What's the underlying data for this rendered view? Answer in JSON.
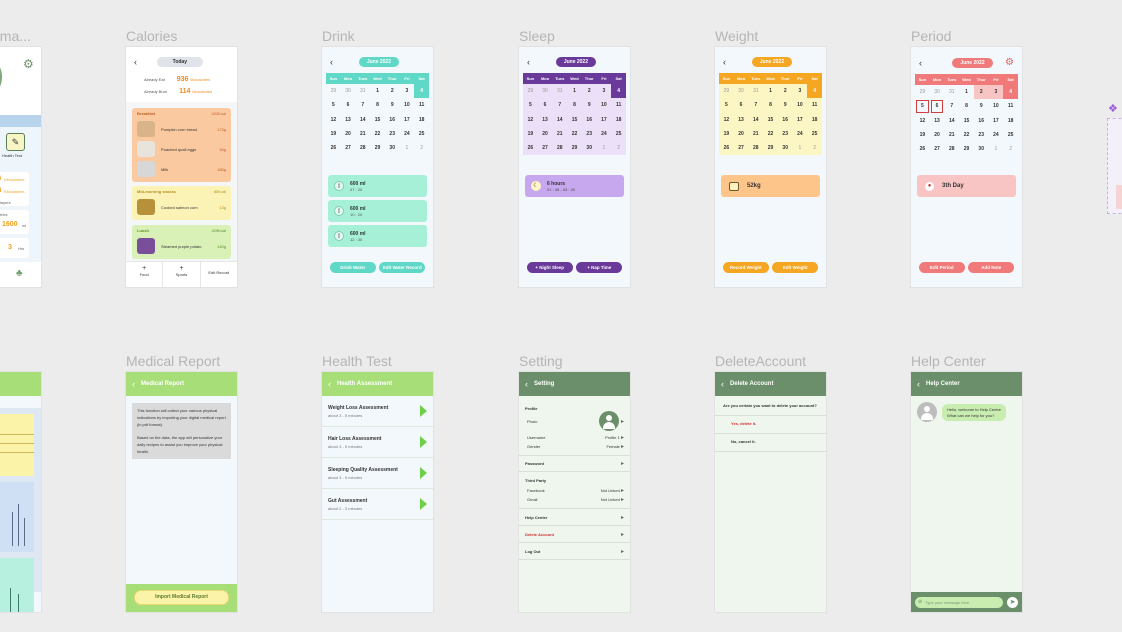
{
  "labels": {
    "partial": "oma...",
    "calories": "Calories",
    "drink": "Drink",
    "sleep": "Sleep",
    "weight": "Weight",
    "period": "Period",
    "medical": "Medical Report",
    "health": "Health Test",
    "setting": "Setting",
    "delete": "DeleteAccount",
    "help": "Help Center"
  },
  "home_partial": {
    "health_test": "Health Test",
    "val1": "6",
    "val1_unit": "Kilocalories",
    "val2": "4",
    "val2_unit": "Kilocalories",
    "bmi": "layers",
    "steps_label": "tries",
    "steps": "1600",
    "steps_unit": "ml",
    "sleep": "3",
    "sleep_unit": "Hrs"
  },
  "calories": {
    "today": "Today",
    "eaten_label": "Already Eat",
    "eaten_value": "936",
    "eaten_unit": "kilocalories",
    "burnt_label": "Already Burn",
    "burnt_value": "114",
    "burnt_unit": "kilocalories",
    "meals": [
      {
        "title": "Breakfast",
        "kcal": "422Kcal",
        "items": [
          {
            "name": "Pumpkin corn bread",
            "amount": "173g"
          },
          {
            "name": "Poached quail eggs",
            "amount": "45g"
          },
          {
            "name": "Milk",
            "amount": "180g"
          }
        ]
      },
      {
        "title": "Mid-morning snacks",
        "kcal": "85Kcal",
        "items": [
          {
            "name": "Cooked salmon corn",
            "amount": "13g"
          }
        ]
      },
      {
        "title": "Lunch",
        "kcal": "429Kcal",
        "items": [
          {
            "name": "Steamed purple potato",
            "amount": "140g"
          }
        ]
      }
    ],
    "footer": [
      {
        "icon": "+",
        "label": "Food"
      },
      {
        "icon": "+",
        "label": "Sports"
      },
      {
        "icon": "",
        "label": "Edit Record"
      }
    ]
  },
  "calendar": {
    "month": "June 2022",
    "weekdays": [
      "Sun",
      "Mon",
      "Tues",
      "Wed",
      "Thur",
      "Fri",
      "Sat"
    ],
    "days": [
      "29",
      "30",
      "31",
      "1",
      "2",
      "3",
      "4",
      "5",
      "6",
      "7",
      "8",
      "9",
      "10",
      "11",
      "12",
      "13",
      "14",
      "15",
      "16",
      "17",
      "18",
      "19",
      "20",
      "21",
      "22",
      "23",
      "24",
      "25",
      "26",
      "27",
      "28",
      "29",
      "30",
      "1",
      "2"
    ]
  },
  "drink": {
    "entries": [
      {
        "amount": "600 ml",
        "time": "07 : 20"
      },
      {
        "amount": "600 ml",
        "time": "10 : 20"
      },
      {
        "amount": "600 ml",
        "time": "12 : 30"
      }
    ],
    "btn1": "Drink Water",
    "btn2": "Edit Water Record"
  },
  "sleep": {
    "hours": "6 hours",
    "range": "21 : 45 - 03 : 20",
    "btn1": "+ Night Sleep",
    "btn2": "+ Nap Time"
  },
  "weight": {
    "value": "52kg",
    "btn1": "Record Weight",
    "btn2": "Edit Weight"
  },
  "period": {
    "day": "3th Day",
    "btn1": "Edit Period",
    "btn2": "Add Note"
  },
  "medical": {
    "header": "Medical Report",
    "para1": "This function will collect your various physical indications by importing your digital medical report (in pdf format).",
    "para2": "Based on the data, the app will personalize your daily recipes to assist you improve your physical health.",
    "btn": "Import Medical Report"
  },
  "health": {
    "header": "Health Assessment",
    "items": [
      {
        "title": "Weight Loss Assessment",
        "sub": "about 3 - 5 minutes"
      },
      {
        "title": "Hair Loss Assessment",
        "sub": "about 3 - 5 minutes"
      },
      {
        "title": "Sleeping Quality Assessment",
        "sub": "about 3 - 5 minutes"
      },
      {
        "title": "Gut Assessment",
        "sub": "about 2 - 3 minutes"
      }
    ]
  },
  "setting": {
    "header": "Setting",
    "profile": "Profile",
    "photo": "Photo",
    "username_label": "Username",
    "username_value": "Profile 1",
    "gender_label": "Gender",
    "gender_value": "Female",
    "password": "Password",
    "third_party": "Third Party",
    "facebook_label": "Facebook",
    "facebook_value": "Not Linked",
    "gmail_label": "Gmail",
    "gmail_value": "Not Linked",
    "help_center": "Help Center",
    "delete_account": "Delete Account",
    "logout": "Log Out"
  },
  "delete": {
    "header": "Delete Account",
    "question": "Are you certain you want to delete your account?",
    "yes": "Yes, delete it.",
    "no": "No, cancel it."
  },
  "help": {
    "header": "Help Center",
    "msg1": "Hello, welcome to Help Centre",
    "msg2": "What can we help for you?",
    "input_placeholder": "Type your message here"
  }
}
